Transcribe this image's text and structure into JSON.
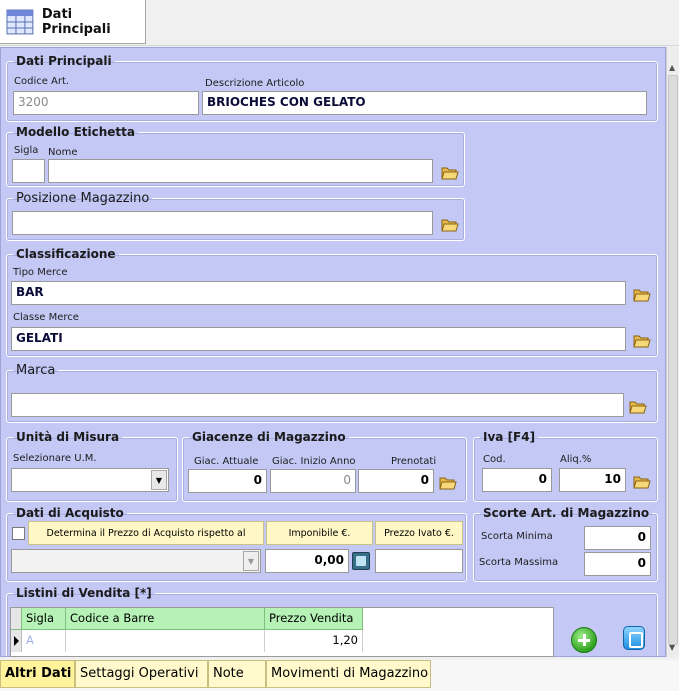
{
  "tab": {
    "label": "Dati Principali"
  },
  "dati_principali": {
    "title": "Dati Principali",
    "codice_label": "Codice Art.",
    "codice_value": "3200",
    "descrizione_label": "Descrizione Articolo",
    "descrizione_value": "BRIOCHES CON GELATO"
  },
  "modello_etichetta": {
    "title": "Modello Etichetta",
    "sigla_label": "Sigla",
    "nome_label": "Nome",
    "sigla_value": "",
    "nome_value": ""
  },
  "posizione_magazzino": {
    "title": "Posizione Magazzino",
    "value": ""
  },
  "classificazione": {
    "title": "Classificazione",
    "tipo_label": "Tipo Merce",
    "tipo_value": "BAR",
    "classe_label": "Classe Merce",
    "classe_value": "GELATI"
  },
  "marca": {
    "title": "Marca",
    "value": ""
  },
  "unita_misura": {
    "title": "Unità di Misura",
    "select_label": "Selezionare U.M.",
    "value": ""
  },
  "giacenze": {
    "title": "Giacenze di Magazzino",
    "attuale_label": "Giac. Attuale",
    "attuale_value": "0",
    "inizio_label": "Giac. Inizio Anno",
    "inizio_value": "0",
    "prenotati_label": "Prenotati",
    "prenotati_value": "0"
  },
  "iva": {
    "title": "Iva [F4]",
    "cod_label": "Cod.",
    "cod_value": "0",
    "aliq_label": "Aliq.%",
    "aliq_value": "10"
  },
  "dati_acquisto": {
    "title": "Dati di Acquisto",
    "determina_label": "Determina il Prezzo di Acquisto rispetto al",
    "imponibile_label": "Imponibile €.",
    "ivato_label": "Prezzo Ivato €.",
    "imponibile_value": "0,00",
    "ivato_value": ""
  },
  "scorte": {
    "title": "Scorte Art. di Magazzino",
    "minima_label": "Scorta Minima",
    "minima_value": "0",
    "massima_label": "Scorta Massima",
    "massima_value": "0"
  },
  "listini": {
    "title": "Listini di Vendita [*]",
    "columns": [
      "Sigla",
      "Codice a Barre",
      "Prezzo Vendita"
    ],
    "rows": [
      {
        "sigla": "A",
        "codice": "",
        "prezzo": "1,20"
      }
    ]
  },
  "bottom_tabs": [
    "Altri Dati",
    "Settaggi Operativi",
    "Note",
    "Movimenti di Magazzino"
  ],
  "colors": {
    "panel": "#c3c8f4",
    "tab_yellow": "#fff9cc",
    "grid_header": "#b6f2b6"
  }
}
